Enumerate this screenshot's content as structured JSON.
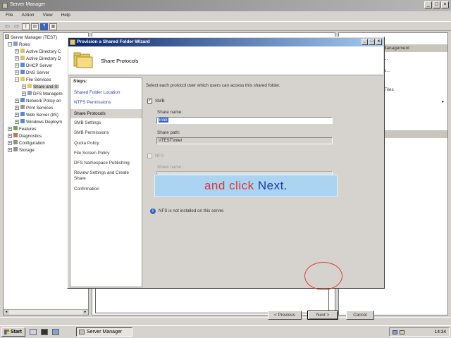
{
  "app": {
    "title": "Server Manager",
    "menu": [
      "File",
      "Action",
      "View",
      "Help"
    ],
    "window_controls": [
      "_",
      "□",
      "×"
    ]
  },
  "tree": {
    "items": [
      {
        "label": "Server Manager (TEST)",
        "expander": ""
      },
      {
        "label": "Roles",
        "expander": "−"
      },
      {
        "label": "Active Directory C",
        "expander": "+"
      },
      {
        "label": "Active Directory D",
        "expander": "+"
      },
      {
        "label": "DHCP Server",
        "expander": "+"
      },
      {
        "label": "DNS Server",
        "expander": "+"
      },
      {
        "label": "File Services",
        "expander": "−"
      },
      {
        "label": "Share and St",
        "expander": "+"
      },
      {
        "label": "DFS Managem",
        "expander": "+"
      },
      {
        "label": "Network Policy an",
        "expander": "+"
      },
      {
        "label": "Print Services",
        "expander": "+"
      },
      {
        "label": "Web Server (IIS)",
        "expander": "+"
      },
      {
        "label": "Windows Deploym",
        "expander": "+"
      },
      {
        "label": "Features",
        "expander": "+"
      },
      {
        "label": "Diagnostics",
        "expander": "+"
      },
      {
        "label": "Configuration",
        "expander": "+"
      },
      {
        "label": "Storage",
        "expander": "+"
      }
    ]
  },
  "actions_pane": {
    "header": "Management",
    "items": [
      "...",
      "s...",
      "Files",
      "▸"
    ]
  },
  "taskbar": {
    "start": "Start",
    "task": "Server Manager",
    "clock": "14:34"
  },
  "wizard": {
    "title": "Provision a Shared Folder Wizard",
    "heading": "Share Protocols",
    "steps_title": "Steps:",
    "steps": [
      {
        "label": "Shared Folder Location",
        "state": "link"
      },
      {
        "label": "NTFS Permissions",
        "state": "link"
      },
      {
        "label": "Share Protocols",
        "state": "active"
      },
      {
        "label": "SMB Settings",
        "state": "plain"
      },
      {
        "label": "SMB Permissions",
        "state": "plain"
      },
      {
        "label": "Quota Policy",
        "state": "plain"
      },
      {
        "label": "File Screen Policy",
        "state": "plain"
      },
      {
        "label": "DFS Namespace Publishing",
        "state": "plain"
      },
      {
        "label": "Review Settings and Create Share",
        "state": "plain"
      },
      {
        "label": "Confirmation",
        "state": "plain"
      }
    ],
    "description": "Select each protocol over which users can access this shared folder.",
    "smb": {
      "checkbox_label": "SMB",
      "checked": true,
      "share_name_label": "Share name:",
      "share_name_value": "intel",
      "share_path_label": "Share path:",
      "share_path_value": "\\\\TEST\\intel"
    },
    "nfs": {
      "checkbox_label": "NFS",
      "checked": false,
      "share_name_label": "Share name:"
    },
    "overlay_caption": {
      "part1": "and click",
      "part2": "Next."
    },
    "info": "NFS is not installed on this server.",
    "buttons": {
      "previous": "< Previous",
      "next": "Next >",
      "cancel": "Cancel"
    }
  }
}
